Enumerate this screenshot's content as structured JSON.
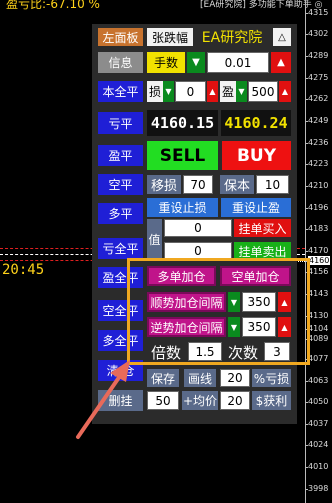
{
  "top": {
    "pnl_text": "盈亏比:-67.10 %",
    "ea_title": "[EA研究院] 多功能下单助手 ◎"
  },
  "axis_labels": [
    "4315",
    "4302",
    "4289",
    "4275",
    "4262",
    "4249",
    "4236",
    "4223",
    "4210",
    "4196",
    "4183",
    "4170",
    "4160",
    "4156",
    "4143",
    "4130",
    "4119",
    "4104",
    "4089",
    "4077",
    "4063",
    "4050",
    "4037",
    "4024",
    "4010",
    "3998",
    "3984",
    "3971",
    "3958"
  ],
  "time": "20:45",
  "panel": {
    "row1": {
      "left_panel": "左面板",
      "rise_fall": "张跌幅",
      "title": "EA研究院"
    },
    "row2": {
      "info": "信息",
      "lots_label": "手数",
      "lots_value": "0.01"
    },
    "row3": {
      "close_all": "本全平",
      "sl_label": "损",
      "sl_value": "0",
      "tp_label": "盈",
      "tp_value": "500"
    },
    "row4": {
      "close_loss": "亏平",
      "bid": "4160.15",
      "ask": "4160.24"
    },
    "row5": {
      "close_profit": "盈平",
      "sell": "SELL",
      "buy": "BUY"
    },
    "row6": {
      "close_short": "空平",
      "move_sl_label": "移损",
      "move_sl_value": "70",
      "breakeven_label": "保本",
      "breakeven_value": "10"
    },
    "row7": {
      "close_long": "多平",
      "reset_sl": "重设止损",
      "reset_tp": "重设止盈"
    },
    "row8": {
      "value_label": "值",
      "buy_pending_value": "0",
      "buy_pending": "挂单买入",
      "sell_pending_value": "0",
      "sell_pending": "挂单卖出"
    },
    "left_extra": {
      "close_all_loss": "亏全平",
      "close_all_profit": "盈全平",
      "close_all_short": "空全平",
      "close_all_long": "多全平",
      "clear": "清 仓",
      "del_pending": "删挂"
    },
    "add": {
      "long_add": "多单加仓",
      "short_add": "空单加仓",
      "trend_gap_label": "顺势加仓间隔",
      "trend_gap_value": "350",
      "counter_gap_label": "逆势加仓间隔",
      "counter_gap_value": "350",
      "multiplier_label": "倍数",
      "multiplier_value": "1.5",
      "times_label": "次数",
      "times_value": "3"
    },
    "bottom": {
      "save": "保存",
      "draw_line": "画线",
      "pct_value": "20",
      "pct_loss": "%亏损",
      "b_value1": "50",
      "plus_avg": "+均价",
      "b_value2": "20",
      "dollar_profit": "$获利"
    }
  },
  "colors": {
    "highlight": "#f0a820",
    "pointer_arrow": "#e86a5a"
  }
}
